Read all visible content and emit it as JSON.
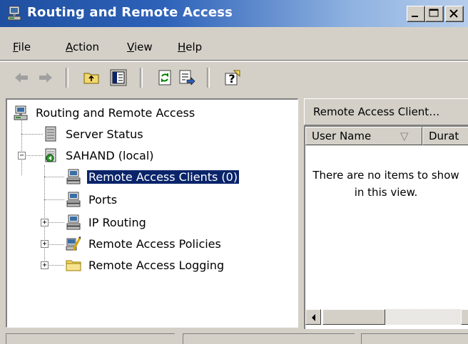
{
  "window": {
    "title": "Routing and Remote Access",
    "icon": "server-icon"
  },
  "title_buttons": [
    {
      "name": "minimize-button",
      "icon": "minimize-icon"
    },
    {
      "name": "maximize-button",
      "icon": "maximize-icon"
    },
    {
      "name": "close-button",
      "icon": "close-icon"
    }
  ],
  "menu": {
    "file": {
      "mnemonic": "F",
      "rest": "ile"
    },
    "action": {
      "mnemonic": "A",
      "rest": "ction"
    },
    "view": {
      "mnemonic": "V",
      "rest": "iew"
    },
    "help": {
      "mnemonic": "H",
      "rest": "elp"
    }
  },
  "toolbar": {
    "buttons": [
      "back-arrow-icon",
      "forward-arrow-icon",
      "up-folder-icon",
      "show-hide-tree-icon",
      "refresh-icon",
      "export-list-icon",
      "help-icon"
    ]
  },
  "tree": {
    "root": "Routing and Remote Access",
    "server_status": "Server Status",
    "server": "SAHAND (local)",
    "items": {
      "remote_access_clients": "Remote Access Clients (0)",
      "ports": "Ports",
      "ip_routing": "IP Routing",
      "remote_access_policies": "Remote Access Policies",
      "remote_access_logging": "Remote Access Logging"
    },
    "expand_symbol": "+",
    "collapse_symbol": "−"
  },
  "right_pane": {
    "header": "Remote Access Client…",
    "columns": [
      "User Name",
      "Durat"
    ],
    "sort_indicator": "▽",
    "empty_message": "There are no items to show in this view."
  },
  "colors": {
    "title_gradient_start": "#1f4fa0",
    "title_gradient_end": "#b6cdec",
    "selection": "#0a246a",
    "face": "#d4d0c8"
  }
}
